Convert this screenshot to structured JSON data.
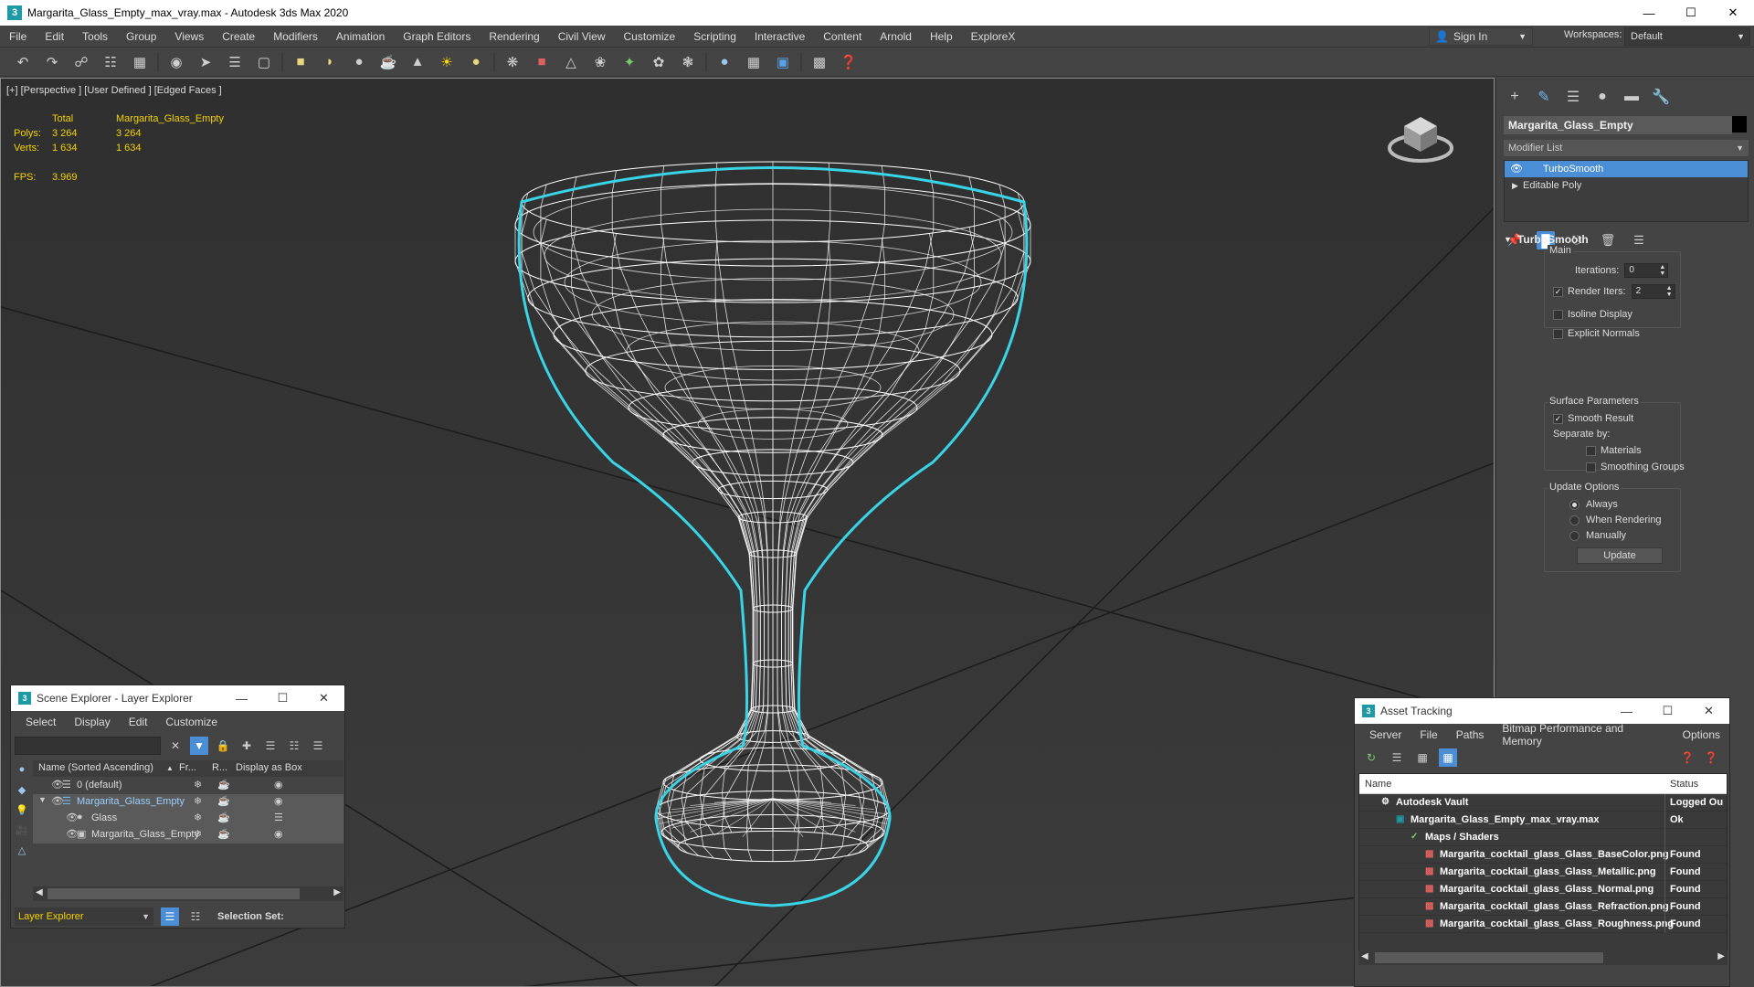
{
  "window": {
    "title": "Margarita_Glass_Empty_max_vray.max - Autodesk 3ds Max 2020",
    "app_icon": "3"
  },
  "menu": {
    "items": [
      "File",
      "Edit",
      "Tools",
      "Group",
      "Views",
      "Create",
      "Modifiers",
      "Animation",
      "Graph Editors",
      "Rendering",
      "Civil View",
      "Customize",
      "Scripting",
      "Interactive",
      "Content",
      "Arnold",
      "Help",
      "ExploreX"
    ],
    "sign_in": "Sign In",
    "workspaces_label": "Workspaces:",
    "workspace_value": "Default"
  },
  "viewport": {
    "label": "[+] [Perspective ] [User Defined ] [Edged Faces ]",
    "stats": {
      "total_label": "Total",
      "object_label": "Margarita_Glass_Empty",
      "polys_label": "Polys:",
      "polys_total": "3 264",
      "polys_obj": "3 264",
      "verts_label": "Verts:",
      "verts_total": "1 634",
      "verts_obj": "1 634",
      "fps_label": "FPS:",
      "fps_value": "3.969"
    },
    "colors": {
      "wire": "#ffffff",
      "selection_outline": "#39d4e6",
      "stats_text": "#f3d300"
    }
  },
  "command_panel": {
    "object_name": "Margarita_Glass_Empty",
    "modifier_list": "Modifier List",
    "stack": [
      {
        "label": "TurboSmooth",
        "selected": true
      },
      {
        "label": "Editable Poly",
        "selected": false
      }
    ],
    "rollout_title": "TurboSmooth",
    "main_group": "Main",
    "iterations_label": "Iterations:",
    "iterations_value": "0",
    "render_iters_label": "Render Iters:",
    "render_iters_value": "2",
    "render_iters_checked": true,
    "isoline_label": "Isoline Display",
    "explicit_normals_label": "Explicit Normals",
    "surface_group": "Surface Parameters",
    "smooth_result_label": "Smooth Result",
    "separate_by_label": "Separate by:",
    "materials_label": "Materials",
    "smoothing_groups_label": "Smoothing Groups",
    "update_group": "Update Options",
    "always_label": "Always",
    "when_rendering_label": "When Rendering",
    "manually_label": "Manually",
    "update_button": "Update"
  },
  "scene_explorer": {
    "title": "Scene Explorer - Layer Explorer",
    "menu": [
      "Select",
      "Display",
      "Edit",
      "Customize"
    ],
    "columns": [
      "Name (Sorted Ascending)",
      "Fr...",
      "R...",
      "Display as Box"
    ],
    "rows": [
      {
        "name": "0 (default)",
        "level": 0
      },
      {
        "name": "Margarita_Glass_Empty",
        "level": 0
      },
      {
        "name": "Glass",
        "level": 1
      },
      {
        "name": "Margarita_Glass_Empty",
        "level": 1
      }
    ],
    "footer_dropdown": "Layer Explorer",
    "selection_set_label": "Selection Set:"
  },
  "asset_tracking": {
    "title": "Asset Tracking",
    "menu": [
      "Server",
      "File",
      "Paths",
      "Bitmap Performance and Memory",
      "Options"
    ],
    "columns": [
      "Name",
      "Status"
    ],
    "rows": [
      {
        "name": "Autodesk Vault",
        "status": "Logged Ou"
      },
      {
        "name": "Margarita_Glass_Empty_max_vray.max",
        "status": "Ok"
      },
      {
        "name": "Maps / Shaders",
        "status": ""
      },
      {
        "name": "Margarita_cocktail_glass_Glass_BaseColor.png",
        "status": "Found"
      },
      {
        "name": "Margarita_cocktail_glass_Glass_Metallic.png",
        "status": "Found"
      },
      {
        "name": "Margarita_cocktail_glass_Glass_Normal.png",
        "status": "Found"
      },
      {
        "name": "Margarita_cocktail_glass_Glass_Refraction.png",
        "status": "Found"
      },
      {
        "name": "Margarita_cocktail_glass_Glass_Roughness.png",
        "status": "Found"
      }
    ]
  }
}
